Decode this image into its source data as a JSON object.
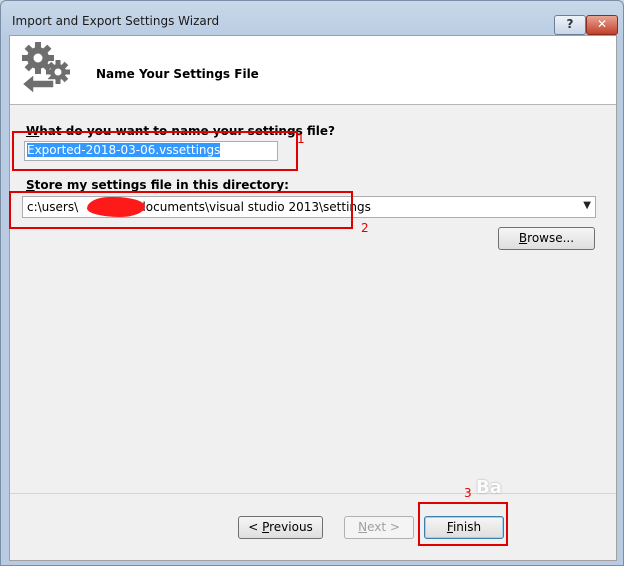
{
  "window": {
    "title": "Import and Export Settings Wizard",
    "help_label": "?",
    "close_label": "✕"
  },
  "header": {
    "title": "Name Your Settings File",
    "icon": "gears-arrow-icon"
  },
  "name_field": {
    "label_prefix": "W",
    "label_rest": "hat do you want to name your settings file?",
    "value": "Exported-2018-03-06.vssettings"
  },
  "dir_field": {
    "label_prefix": "S",
    "label_rest": "tore my settings file in this directory:",
    "value_start": "c:\\users\\",
    "value_end": "documents\\visual studio 2013\\settings"
  },
  "buttons": {
    "browse": {
      "prefix": "B",
      "rest": "rowse..."
    },
    "previous": {
      "pre": "< ",
      "key": "P",
      "rest": "revious"
    },
    "next": {
      "key": "N",
      "rest": "ext >"
    },
    "finish": {
      "key": "F",
      "rest": "inish"
    }
  },
  "annotations": {
    "one": "1",
    "two": "2",
    "three": "3"
  },
  "watermark": "Ba",
  "colors": {
    "annotation": "#e00000",
    "selection": "#3399ff"
  }
}
